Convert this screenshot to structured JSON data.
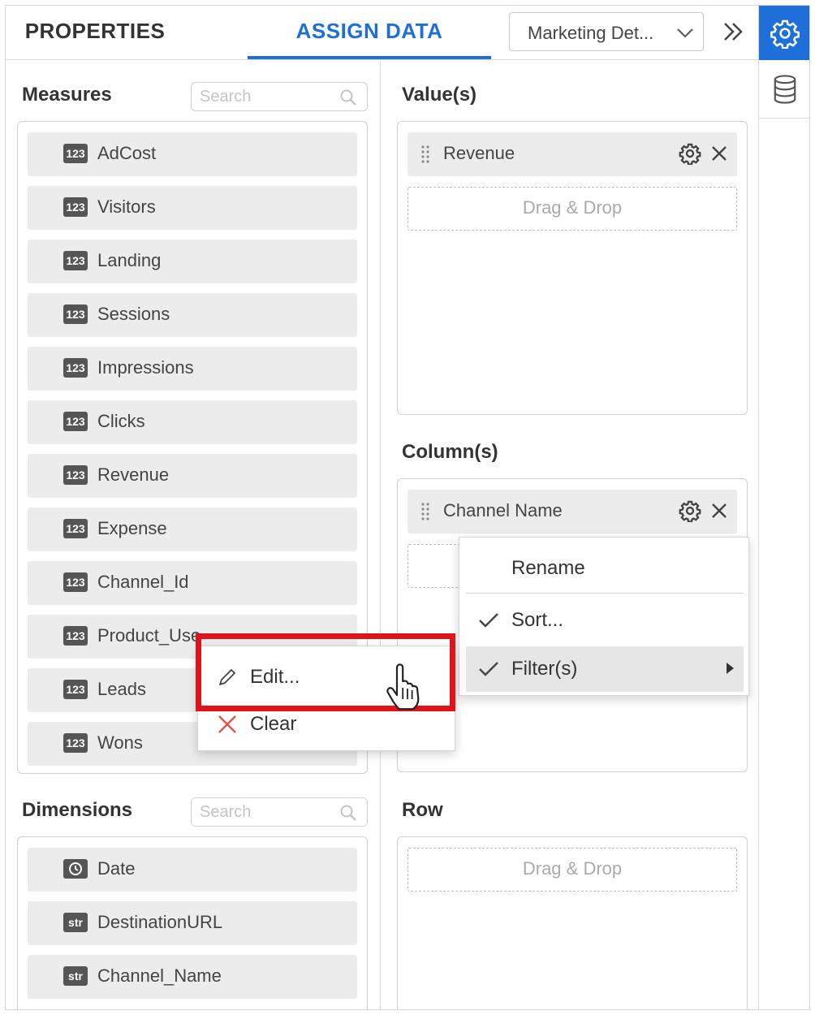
{
  "header": {
    "tabs": [
      {
        "label": "PROPERTIES",
        "active": false
      },
      {
        "label": "ASSIGN DATA",
        "active": true
      }
    ],
    "datasource_select": {
      "value": "Marketing Det..."
    },
    "expand_icon": "double-chevron-right-icon"
  },
  "rail": {
    "buttons": [
      {
        "icon": "gear-icon",
        "active": true
      },
      {
        "icon": "database-icon",
        "active": false
      }
    ]
  },
  "measures": {
    "title": "Measures",
    "search_placeholder": "Search",
    "items": [
      {
        "type": "123",
        "label": "AdCost"
      },
      {
        "type": "123",
        "label": "Visitors"
      },
      {
        "type": "123",
        "label": "Landing"
      },
      {
        "type": "123",
        "label": "Sessions"
      },
      {
        "type": "123",
        "label": "Impressions"
      },
      {
        "type": "123",
        "label": "Clicks"
      },
      {
        "type": "123",
        "label": "Revenue"
      },
      {
        "type": "123",
        "label": "Expense"
      },
      {
        "type": "123",
        "label": "Channel_Id"
      },
      {
        "type": "123",
        "label": "Product_Use"
      },
      {
        "type": "123",
        "label": "Leads"
      },
      {
        "type": "123",
        "label": "Wons"
      }
    ]
  },
  "dimensions": {
    "title": "Dimensions",
    "search_placeholder": "Search",
    "items": [
      {
        "type": "clock",
        "label": "Date"
      },
      {
        "type": "str",
        "label": "DestinationURL"
      },
      {
        "type": "str",
        "label": "Channel_Name"
      }
    ]
  },
  "values": {
    "title": "Value(s)",
    "pill": "Revenue",
    "drop_text": "Drag & Drop"
  },
  "columns": {
    "title": "Column(s)",
    "pill": "Channel Name"
  },
  "row": {
    "title": "Row",
    "drop_text": "Drag & Drop"
  },
  "context_menu": {
    "items": [
      {
        "label": "Rename",
        "checked": false
      },
      {
        "label": "Sort...",
        "checked": true
      },
      {
        "label": "Filter(s)",
        "checked": true,
        "submenu": true,
        "hovered": true
      }
    ]
  },
  "filter_submenu": {
    "items": [
      {
        "label": "Edit...",
        "icon": "pencil-icon",
        "highlighted": true
      },
      {
        "label": "Clear",
        "icon": "close-icon"
      }
    ]
  },
  "colors": {
    "accent": "#1e6fd9",
    "highlight": "#e0131b",
    "item_bg": "#ececec"
  }
}
